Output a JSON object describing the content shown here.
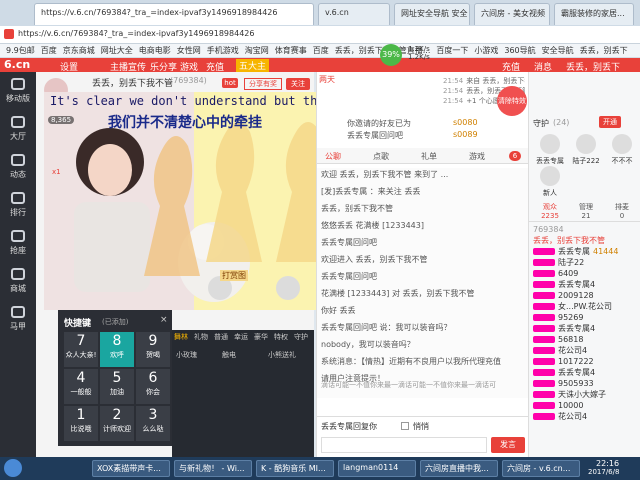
{
  "browser": {
    "tabs": [
      {
        "label": "https://v.6.cn/769384?_tra_=index-ipvaf3y1496918984426"
      },
      {
        "label": "v.6.cn"
      },
      {
        "label": "网址安全导航 安全"
      },
      {
        "label": "六间房 - 美女视频"
      },
      {
        "label": "霸服装修的家居..."
      }
    ],
    "url": "https://v.6.cn/769384?_tra_=index-ipvaf3y1496918984426",
    "bookmarks": [
      "9.9包邮",
      "百度",
      "京东商城",
      "网址大全",
      "电商电影",
      "女性网",
      "手机游戏",
      "淘宝网",
      "体育赛事",
      "百度",
      "丢丢，别丢下我不管直播...",
      "百度一下",
      "小游戏",
      "360导航",
      "安全导航",
      "丢丢，别丢下"
    ],
    "speed": "39%",
    "speed_up": "1.2K/s",
    "speed_down": "1.2K/s"
  },
  "site": {
    "logo": "6.cn",
    "header_items": [
      "设置",
      "主播宣传",
      "乐分享",
      "游戏",
      "充值",
      "五大主"
    ],
    "header_right": [
      "充值",
      "消息",
      "丢丢，别丢下"
    ],
    "nav": [
      "移动版",
      "大厅",
      "动态",
      "排行",
      "抢座",
      "商城",
      "马甲"
    ]
  },
  "anchor": {
    "name": "丢丢，别丢下我不管",
    "room_id": "(769384)",
    "badge": "hot",
    "share_label": "分享有奖",
    "follow_label": "关注",
    "fans": "8,365",
    "lyric_en": "It's clear we don't understand but th",
    "lyric_cn": "我们并不清楚心中的牵挂",
    "hat": "x1",
    "gift_name": "打赏图"
  },
  "quick_panel": {
    "title": "快捷键",
    "subtitle": "(已添加)",
    "items": [
      {
        "num": "7",
        "label": "众人大亲!"
      },
      {
        "num": "8",
        "label": "欢呼"
      },
      {
        "num": "9",
        "label": "贺喝"
      },
      {
        "num": "4",
        "label": "一般般"
      },
      {
        "num": "5",
        "label": "加油"
      },
      {
        "num": "6",
        "label": "你会"
      },
      {
        "num": "1",
        "label": "比说哦"
      },
      {
        "num": "2",
        "label": "计师欢迎"
      },
      {
        "num": "3",
        "label": "么么哒"
      }
    ]
  },
  "gift_tabs": [
    "舞林",
    "礼物",
    "普通",
    "幸运",
    "豪华",
    "特权",
    "守护"
  ],
  "gift_labels": [
    "小玫瑰",
    "触电",
    "小熊送礼"
  ],
  "chat": {
    "notice": "两天",
    "top_messages": [
      {
        "time": "21:54",
        "text": "来自 丢丢，别丢下我不管"
      },
      {
        "time": "21:54",
        "text": "丢丢，别丢下我不管"
      },
      {
        "time": "21:54",
        "text": "+1 个心愿手册"
      }
    ],
    "line1": "你邀请的好友已为",
    "line2": "丢丢专属回问吧",
    "coins": "s0080",
    "coins2": "s0089",
    "tabs": [
      "公聊",
      "点歌",
      "礼单",
      "游戏"
    ],
    "tab_badge": "6",
    "messages": [
      "欢迎 丢丢，别丢下我不管 来到了 ...",
      "[发]丢丢专属 ：来关注 丢丢",
      "丢丢，别丢下我不管",
      "悠悠丢丢 花满楼 [1233443]",
      "丢丢专属回问吧",
      "欢迎进入 丢丢，别丢下我不管",
      "丢丢专属回问吧",
      "花满楼 [1233443] 对 丢丢，别丢下我不管",
      "你好 丢丢",
      "丢丢专属回问吧 说：我可以装音吗？",
      "nobody，我可以装音吗？",
      "系统消息：【情热】近期有不良用户以我所代理充值",
      "请用户注意提示！"
    ],
    "scroll_notice": "滴话可能一不值你来最一滴话可能一不值你来最一滴话可",
    "input_to": "丢丢专属回复你",
    "checkbox": "悄悄",
    "send_label": "发言",
    "promo": "清除特效"
  },
  "right": {
    "guard_title": "守护",
    "guard_count": "(24)",
    "open_label": "开通",
    "guards": [
      "丢丢专属",
      "陆子222",
      "不不不"
    ],
    "guard4": "新人",
    "tabs": [
      {
        "label": "观众",
        "count": "2235"
      },
      {
        "label": "管理",
        "count": "21"
      },
      {
        "label": "排麦",
        "count": "0"
      }
    ],
    "top_user": "丢丢，别丢下我不管",
    "top_id": "769384",
    "viewers": [
      {
        "name": "丢丢专属",
        "badge": "41444"
      },
      {
        "name": "陆子22"
      },
      {
        "name": "6409"
      },
      {
        "name": "丢丢专属4"
      },
      {
        "name": "2009128"
      },
      {
        "name": "女...PW.花公司"
      },
      {
        "name": "95269"
      },
      {
        "name": "丢丢专属4"
      },
      {
        "name": "56818"
      },
      {
        "name": "花公司4"
      },
      {
        "name": "1017222"
      },
      {
        "name": "丢丢专属4"
      },
      {
        "name": "9505933"
      },
      {
        "name": "天诛小大嫁子"
      },
      {
        "name": "10000"
      },
      {
        "name": "花公司4"
      }
    ]
  },
  "taskbar": {
    "items": [
      "XOX素描带声卡...",
      "与新礼物！ - Wi...",
      "K - 酷狗音乐 MI...",
      "langman0114",
      "六间房直播中我...",
      "六间房 - v.6.cn..."
    ],
    "time": "22:16",
    "date": "2017/6/8"
  }
}
